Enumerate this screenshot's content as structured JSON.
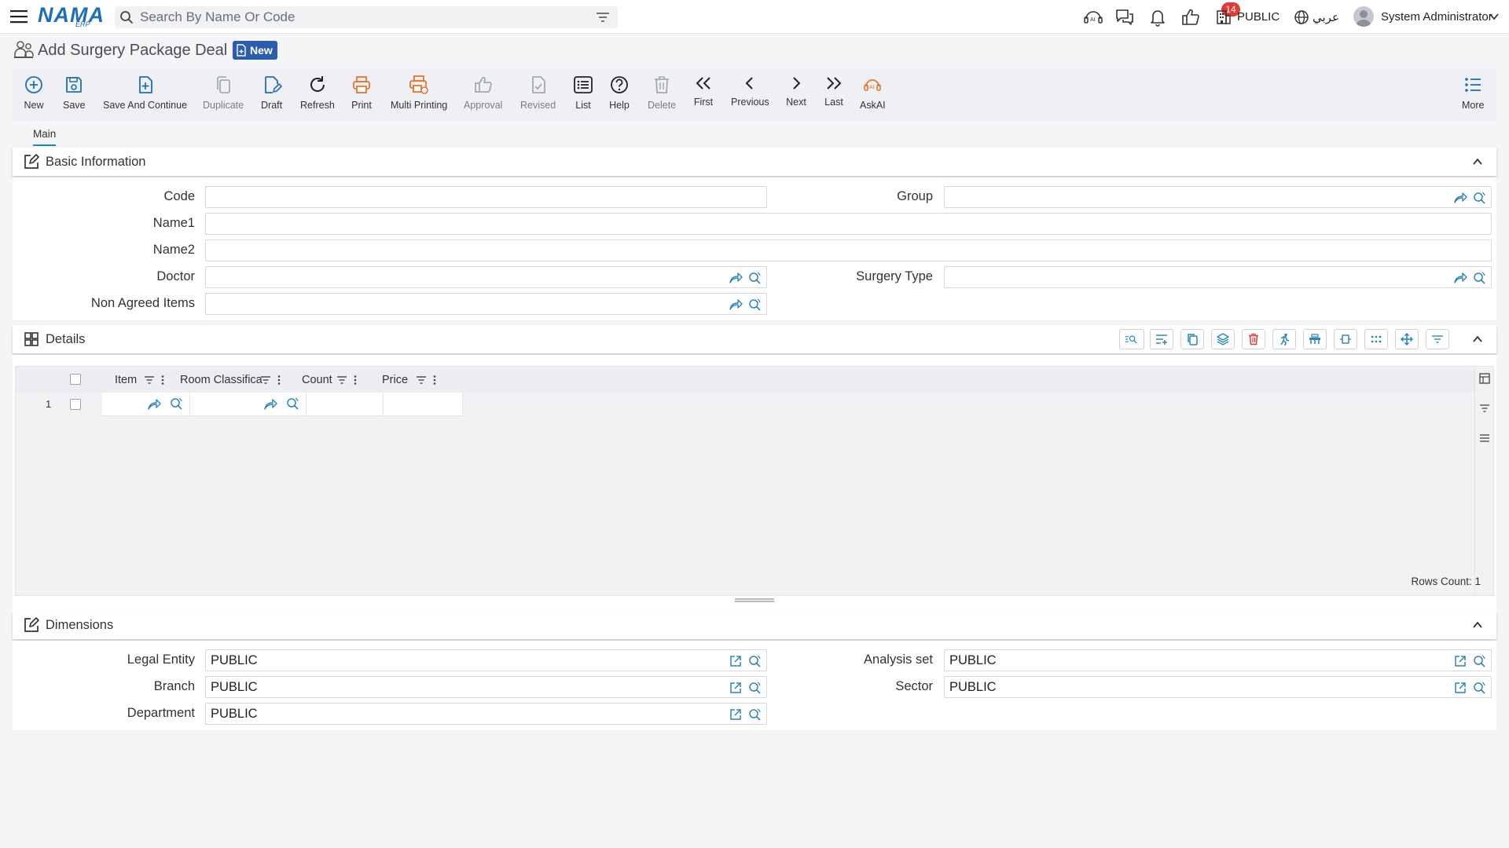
{
  "app": {
    "logo_text": "NAMA",
    "logo_sub": "ERP",
    "search_placeholder": "Search By Name Or Code",
    "notification_count": "14",
    "company": "PUBLIC",
    "language": "عربي",
    "user": "System Administrator"
  },
  "page": {
    "title": "Add Surgery Package Deal",
    "status_badge": "New"
  },
  "toolbar": {
    "new": "New",
    "save": "Save",
    "save_continue": "Save And Continue",
    "duplicate": "Duplicate",
    "draft": "Draft",
    "refresh": "Refresh",
    "print": "Print",
    "multi_printing": "Multi Printing",
    "approval": "Approval",
    "revised": "Revised",
    "list": "List",
    "help": "Help",
    "delete": "Delete",
    "first": "First",
    "previous": "Previous",
    "next": "Next",
    "last": "Last",
    "askai": "AskAI",
    "more": "More"
  },
  "tabs": [
    "Main"
  ],
  "basic_info": {
    "title": "Basic Information",
    "code_label": "Code",
    "code_value": "",
    "group_label": "Group",
    "group_value": "",
    "name1_label": "Name1",
    "name1_value": "",
    "name2_label": "Name2",
    "name2_value": "",
    "doctor_label": "Doctor",
    "doctor_value": "",
    "surgery_type_label": "Surgery Type",
    "surgery_type_value": "",
    "non_agreed_label": "Non Agreed Items",
    "non_agreed_value": ""
  },
  "details": {
    "title": "Details",
    "columns": [
      "Item",
      "Room Classifica",
      "Count",
      "Price"
    ],
    "rows": [
      {
        "num": "1",
        "item": "",
        "room": "",
        "count": "",
        "price": ""
      }
    ],
    "rows_count": "Rows Count: 1"
  },
  "dimensions": {
    "title": "Dimensions",
    "legal_entity_label": "Legal Entity",
    "legal_entity_value": "PUBLIC",
    "analysis_set_label": "Analysis set",
    "analysis_set_value": "PUBLIC",
    "branch_label": "Branch",
    "branch_value": "PUBLIC",
    "sector_label": "Sector",
    "sector_value": "PUBLIC",
    "department_label": "Department",
    "department_value": "PUBLIC"
  },
  "colors": {
    "accent": "#1f6fb6",
    "orange": "#e8742c",
    "badge_blue": "#2a5db0",
    "danger": "#e53935"
  }
}
